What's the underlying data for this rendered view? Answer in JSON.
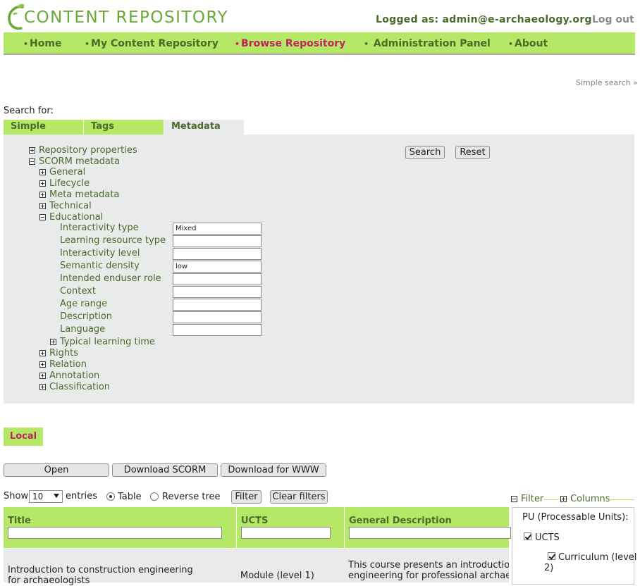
{
  "header": {
    "logo_text": "CONTENT REPOSITORY",
    "logged_as": "Logged as: admin@e-archaeology.org",
    "logout_label": "Log out"
  },
  "nav": {
    "items": [
      {
        "label": "Home"
      },
      {
        "label": "My Content Repository"
      },
      {
        "label": "Browse Repository"
      },
      {
        "label": "Administration Panel"
      },
      {
        "label": "About"
      }
    ],
    "active": "Browse Repository"
  },
  "search": {
    "simple_search_link": "Simple search »",
    "search_for_label": "Search for:",
    "tabs": [
      {
        "label": "Simple"
      },
      {
        "label": "Tags"
      },
      {
        "label": "Metadata"
      }
    ],
    "current_tab": "Metadata",
    "search_button": "Search",
    "reset_button": "Reset"
  },
  "tree": {
    "repository_properties": "Repository properties",
    "scorm_metadata": "SCORM metadata",
    "general": "General",
    "lifecycle": "Lifecycle",
    "meta_metadata": "Meta metadata",
    "technical": "Technical",
    "educational": "Educational",
    "fields": [
      {
        "label": "Interactivity type",
        "value": "Mixed"
      },
      {
        "label": "Learning resource type",
        "value": ""
      },
      {
        "label": "Interactivity level",
        "value": ""
      },
      {
        "label": "Semantic density",
        "value": "low"
      },
      {
        "label": "Intended enduser role",
        "value": ""
      },
      {
        "label": "Context",
        "value": ""
      },
      {
        "label": "Age range",
        "value": ""
      },
      {
        "label": "Description",
        "value": ""
      },
      {
        "label": "Language",
        "value": ""
      }
    ],
    "typical_learning_time": "Typical learning time",
    "rights": "Rights",
    "relation": "Relation",
    "annotation": "Annotation",
    "classification": "Classification"
  },
  "results": {
    "local_tab": "Local",
    "open_button": "Open",
    "download_scorm_button": "Download SCORM",
    "download_www_button": "Download for WWW",
    "show_label": "Show",
    "entries_value": "10",
    "entries_label": "entries",
    "view_table_label": "Table",
    "view_reverse_label": "Reverse tree",
    "view_selected": "Table",
    "filter_button": "Filter",
    "clear_filters_button": "Clear filters",
    "columns": [
      {
        "label": "Title"
      },
      {
        "label": "UCTS"
      },
      {
        "label": "General Description"
      }
    ],
    "rows": [
      {
        "title_line1": "Introduction to construction engineering",
        "title_line2": "for archaeologists",
        "ucts": "Module (level 1)",
        "desc_line1": "This course presents an introduction to",
        "desc_line2": "engineering for professional archaeologists"
      }
    ]
  },
  "filter_panel": {
    "filter_label": "Filter",
    "columns_label": "Columns",
    "pu_label": "PU (Processable Units):",
    "ucts_label": "UCTS",
    "curriculum_line1": "Curriculum (level",
    "curriculum_line2": "2)"
  },
  "colors": {
    "accent_green": "#b4e866",
    "text_green": "#4c6a2a",
    "active_red": "#c0245c",
    "panel_gray": "#e9ebea"
  }
}
